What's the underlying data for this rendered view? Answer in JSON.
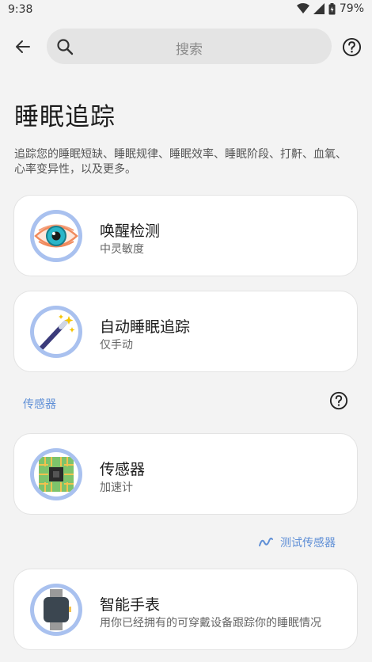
{
  "status_bar": {
    "time": "9:38",
    "battery": "79%"
  },
  "search": {
    "placeholder": "搜索"
  },
  "page": {
    "title": "睡眠追踪",
    "description": "追踪您的睡眠短缺、睡眠规律、睡眠效率、睡眠阶段、打鼾、血氧、心率变异性，以及更多。"
  },
  "cards": [
    {
      "title": "唤醒检测",
      "subtitle": "中灵敏度",
      "icon": "eye-icon"
    },
    {
      "title": "自动睡眠追踪",
      "subtitle": "仅手动",
      "icon": "magic-wand-icon"
    }
  ],
  "sensor_section": {
    "label": "传感器",
    "card": {
      "title": "传感器",
      "subtitle": "加速计",
      "icon": "chip-icon"
    },
    "test_label": "测试传感器"
  },
  "watch_card": {
    "title": "智能手表",
    "subtitle": "用你已经拥有的可穿戴设备跟踪你的睡眠情况",
    "icon": "smartwatch-icon"
  },
  "colors": {
    "accent": "#5f8fd6",
    "icon_ring": "#a9c1ef",
    "background": "#f3f3f3"
  }
}
